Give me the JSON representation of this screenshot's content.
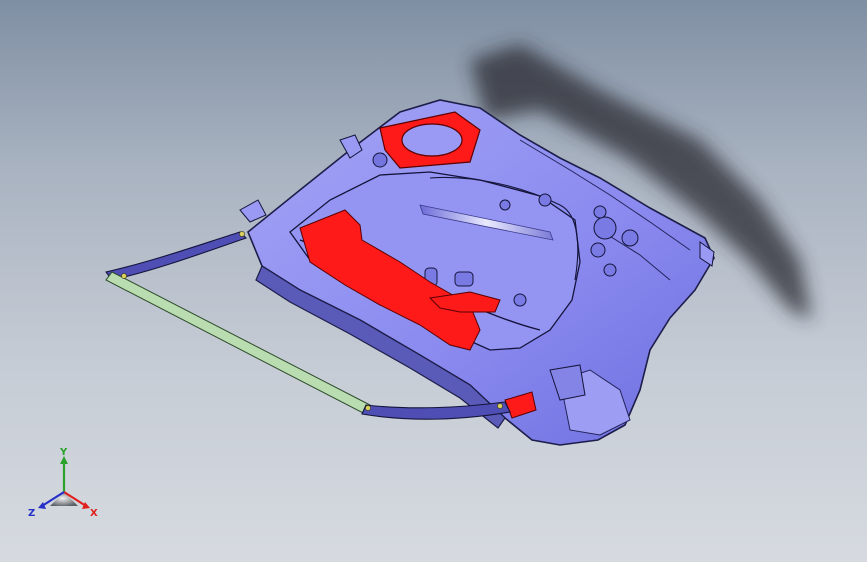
{
  "viewport": {
    "background_top": "#7f8fa3",
    "background_bottom": "#d6dae0"
  },
  "model": {
    "panel_color": "#8e8ef2",
    "outline_color": "#1d1d4a",
    "highlight_color": "#ff1a1a",
    "seal_color": "#b9dcb0",
    "shadow_color": "#2e2f33"
  },
  "triad": {
    "x_label": "X",
    "y_label": "Y",
    "z_label": "Z",
    "x_color": "#e0201c",
    "y_color": "#2aa12a",
    "z_color": "#2530c8"
  }
}
